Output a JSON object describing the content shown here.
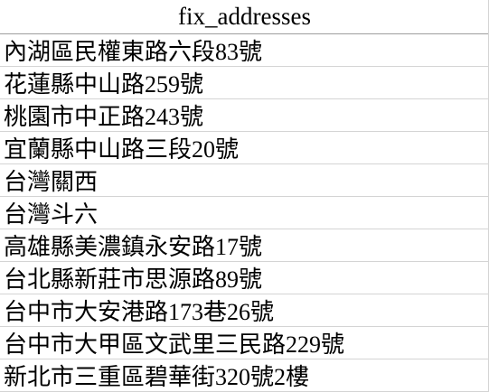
{
  "sheet": {
    "column_header": "fix_addresses",
    "rows": [
      "內湖區民權東路六段83號",
      "花蓮縣中山路259號",
      "桃園市中正路243號",
      "宜蘭縣中山路三段20號",
      "台灣關西",
      "台灣斗六",
      "高雄縣美濃鎮永安路17號",
      "台北縣新莊市思源路89號",
      "台中市大安港路173巷26號",
      "台中市大甲區文武里三民路229號",
      "新北市三重區碧華街320號2樓"
    ]
  }
}
